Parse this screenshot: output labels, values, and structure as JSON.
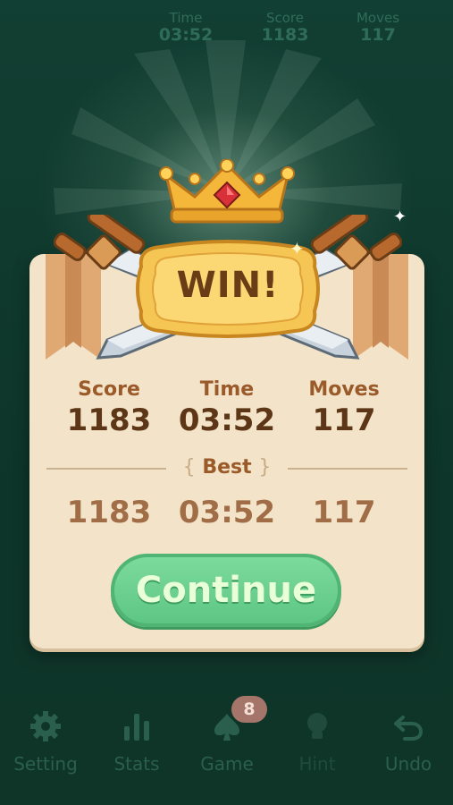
{
  "top_bar": {
    "time": {
      "label": "Time",
      "value": "03:52"
    },
    "score": {
      "label": "Score",
      "value": "1183"
    },
    "moves": {
      "label": "Moves",
      "value": "117"
    }
  },
  "dialog": {
    "title": "WIN!",
    "current": {
      "score": {
        "label": "Score",
        "value": "1183"
      },
      "time": {
        "label": "Time",
        "value": "03:52"
      },
      "moves": {
        "label": "Moves",
        "value": "117"
      }
    },
    "best_label": "Best",
    "best": {
      "score": "1183",
      "time": "03:52",
      "moves": "117"
    },
    "continue_label": "Continue"
  },
  "bottom_nav": {
    "setting": "Setting",
    "stats": "Stats",
    "game": "Game",
    "game_badge": "8",
    "hint": "Hint",
    "undo": "Undo"
  },
  "colors": {
    "background": "#0f3a2e",
    "panel": "#f3e3c8",
    "continue_button": "#6ad28f",
    "title_text": "#6b3d17"
  },
  "icons": [
    "gear-icon",
    "bar-chart-icon",
    "spade-icon",
    "lightbulb-icon",
    "undo-arrow-icon",
    "crown-icon",
    "crossed-swords-icon"
  ]
}
